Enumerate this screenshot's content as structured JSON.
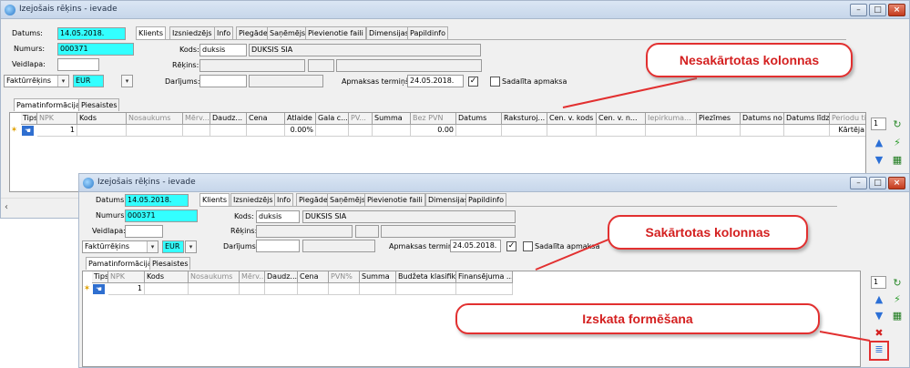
{
  "top_window": {
    "title": "Izejošais rēķins - ievade",
    "labels": {
      "datums": "Datums:",
      "numurs": "Numurs:",
      "veidlapa": "Veidlapa:",
      "kods": "Kods:",
      "rekins": "Rēķins:",
      "darijums": "Darījums:",
      "apmaksas_termins": "Apmaksas termiņš:",
      "sadalita_apmaksa": "Sadalīta apmaksa"
    },
    "values": {
      "datums": "14.05.2018.",
      "numurs": "000371",
      "veidlapa": "",
      "doc_type": "Faktūrrēķins",
      "currency": "EUR",
      "kods": "duksis",
      "klients_name": "DUKSIS SIA",
      "apmaksas_termins": "24.05.2018."
    },
    "tabs": [
      "Klients",
      "Izsniedzējs",
      "Info",
      "Piegāde",
      "Saņēmējs",
      "Pievienotie faili",
      "Dimensijas",
      "Papildinfo"
    ],
    "subtabs": [
      "Pamatinformācija",
      "Piesaistes"
    ],
    "columns": [
      "Tips",
      "NPK",
      "Kods",
      "Nosaukums",
      "Mērv...",
      "Daudz...",
      "Cena",
      "Atlaide",
      "Gala c...",
      "PV...",
      "Summa",
      "Bez PVN",
      "Datums",
      "Raksturoj...",
      "Cen. v. kods",
      "Cen. v. n...",
      "Iepirkuma...",
      "Piezīmes",
      "Datums no",
      "Datums līdz",
      "Periodu tips"
    ],
    "row": {
      "npk": "1",
      "atlaide": "0.00%",
      "bez_pvn": "0.00",
      "periodu_tips": "Kārtēja"
    },
    "side_field": "1"
  },
  "bottom_window": {
    "title": "Izejošais rēķins - ievade",
    "labels": {
      "datums": "Datums:",
      "numurs": "Numurs:",
      "veidlapa": "Veidlapa:",
      "kods": "Kods:",
      "rekins": "Rēķins:",
      "darijums": "Darījums:",
      "apmaksas_termins": "Apmaksas termiņš:",
      "sadalita_apmaksa": "Sadalīta apmaksa"
    },
    "values": {
      "datums": "14.05.2018.",
      "numurs": "000371",
      "veidlapa": "",
      "doc_type": "Faktūrrēķins",
      "currency": "EUR",
      "kods": "duksis",
      "klients_name": "DUKSIS SIA",
      "apmaksas_termins": "24.05.2018."
    },
    "tabs": [
      "Klients",
      "Izsniedzējs",
      "Info",
      "Piegāde",
      "Saņēmējs",
      "Pievienotie faili",
      "Dimensijas",
      "Papildinfo"
    ],
    "subtabs": [
      "Pamatinformācija",
      "Piesaistes"
    ],
    "columns": [
      "Tips",
      "NPK",
      "Kods",
      "Nosaukums",
      "Mērv...",
      "Daudz...",
      "Cena",
      "PVN%",
      "Summa",
      "Budžeta klasifik...",
      "Finansējuma ..."
    ],
    "row": {
      "npk": "1"
    },
    "side_field": "1"
  },
  "callouts": {
    "unsorted": "Nesakārtotas kolonnas",
    "sorted": "Sakārtotas kolonnas",
    "view_shaping": "Izskata formēšana"
  },
  "colors": {
    "highlight_field": "#33ffff",
    "callout_red": "#e23030",
    "titlebar": "#c6d6ea"
  },
  "icons": [
    "app-icon",
    "minimize-icon",
    "maximize-icon",
    "close-icon",
    "hand-icon",
    "refresh-icon",
    "arrow-up-icon",
    "arrow-down-icon",
    "lightning-icon",
    "excel-icon",
    "delete-icon",
    "column-layout-icon"
  ]
}
